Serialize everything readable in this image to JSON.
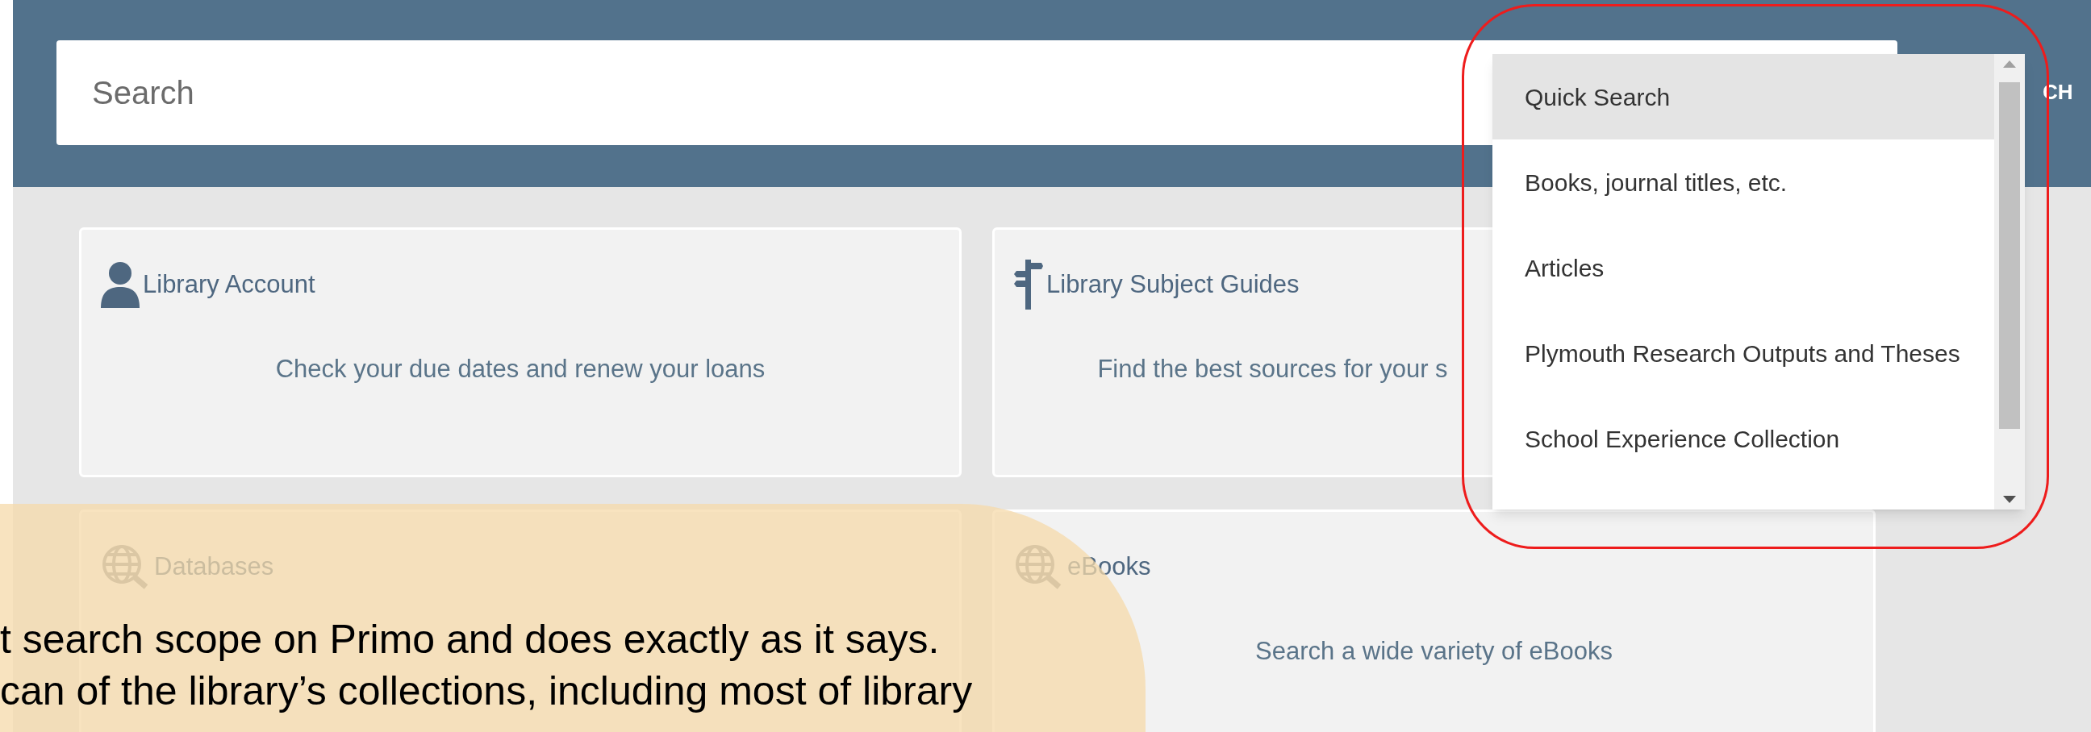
{
  "search": {
    "placeholder": "Search"
  },
  "search_button": {
    "label": "CH"
  },
  "cards": [
    {
      "kind": "account",
      "title": "Library Account",
      "description": "Check your due dates and renew your loans"
    },
    {
      "kind": "guides",
      "title": "Library Subject Guides",
      "description": "Find the best sources for your s"
    },
    {
      "kind": "globe",
      "title": "Databases"
    },
    {
      "kind": "globe",
      "title": "eBooks",
      "description": "Search a wide variety of eBooks"
    }
  ],
  "scope_menu": {
    "items": [
      {
        "label": "Quick Search",
        "selected": true
      },
      {
        "label": "Books, journal titles, etc.",
        "selected": false
      },
      {
        "label": "Articles",
        "selected": false
      },
      {
        "label": "Plymouth Research Outputs and Theses",
        "selected": false
      },
      {
        "label": "School Experience Collection",
        "selected": false
      }
    ]
  },
  "callout": {
    "lines": [
      "t search scope on Primo and does exactly as it says.",
      "can of the library’s collections, including most of library"
    ]
  }
}
